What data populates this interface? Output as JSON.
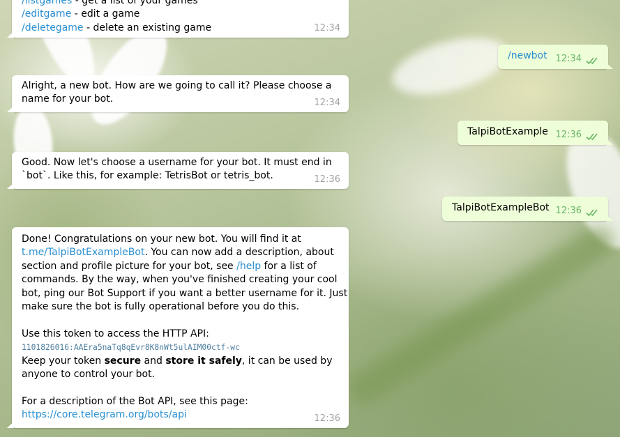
{
  "background": {
    "name": "daisy-wallpaper"
  },
  "colors": {
    "link": "#2a8fd0",
    "incoming_bubble": "#ffffff",
    "outgoing_bubble": "#eefed8",
    "time_in": "#a3a3a3",
    "time_out": "#6ab56a"
  },
  "messages": [
    {
      "direction": "in",
      "lines": [
        {
          "link": "/listgames",
          "text": " - get a list of your games"
        },
        {
          "link": "/editgame",
          "text": " - edit a game"
        },
        {
          "link": "/deletegame",
          "text": " - delete an existing game"
        }
      ],
      "time": "12:34"
    },
    {
      "direction": "out",
      "text": "/newbot",
      "is_command": true,
      "time": "12:34",
      "status_icon": "double-check-icon"
    },
    {
      "direction": "in",
      "lines": [
        "Alright, a new bot. How are we going to call it? Please choose a",
        "name for your bot."
      ],
      "time": "12:34"
    },
    {
      "direction": "out",
      "text": "TalpiBotExample",
      "time": "12:36",
      "status_icon": "double-check-icon"
    },
    {
      "direction": "in",
      "lines": [
        "Good. Now let's choose a username for your bot. It must end in",
        "`bot`. Like this, for example: TetrisBot or tetris_bot."
      ],
      "time": "12:36"
    },
    {
      "direction": "out",
      "text": "TalpiBotExampleBot",
      "time": "12:36",
      "status_icon": "double-check-icon"
    },
    {
      "direction": "in",
      "time": "12:36",
      "l1": "Done! Congratulations on your new bot. You will find it at",
      "l2_link": "t.me/TalpiBotExampleBot",
      "l2_text": ". You can now add a description, about",
      "l3_text": "section and profile picture for your bot, see ",
      "l3_link": "/help",
      "l3_tail": " for a list of",
      "l4": "commands. By the way, when you've finished creating your cool",
      "l5": "bot, ping our Bot Support if you want a better username for it. Just",
      "l6": "make sure the bot is fully operational before you do this.",
      "l7": "Use this token to access the HTTP API:",
      "token": "1101826016:AAEra5naTq8qEvr8K8nWt5ulAIM00ctf-wc",
      "l9_a": "Keep your token ",
      "l9_b1": "secure",
      "l9_c": " and ",
      "l9_b2": "store it safely",
      "l9_d": ", it can be used by",
      "l10": "anyone to control your bot.",
      "l11": "For a description of the Bot API, see this page:",
      "l12_link": "https://core.telegram.org/bots/api"
    }
  ]
}
